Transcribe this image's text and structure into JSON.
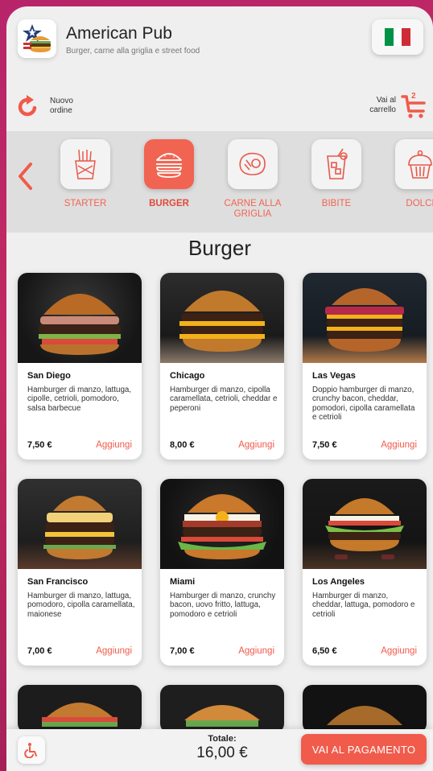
{
  "header": {
    "title": "American Pub",
    "subtitle": "Burger, carne alla griglia e street food",
    "flag_colors": [
      "#009246",
      "#ffffff",
      "#ce2b37"
    ]
  },
  "actions": {
    "new_order": "Nuovo ordine",
    "cart_label": "Vai al carrello",
    "cart_count": "2"
  },
  "categories": [
    {
      "label": "STARTER",
      "icon": "fries-icon",
      "active": false
    },
    {
      "label": "BURGER",
      "icon": "burger-icon",
      "active": true
    },
    {
      "label": "CARNE ALLA GRIGLIA",
      "icon": "steak-icon",
      "active": false
    },
    {
      "label": "BIBITE",
      "icon": "drink-icon",
      "active": false
    },
    {
      "label": "DOLCI",
      "icon": "cupcake-icon",
      "active": false
    }
  ],
  "section_title": "Burger",
  "add_label": "Aggiungi",
  "products": [
    {
      "name": "San Diego",
      "desc": "Hamburger di manzo, lattuga, cipolle, cetrioli, pomodoro, salsa barbecue",
      "price": "7,50 €"
    },
    {
      "name": "Chicago",
      "desc": "Hamburger di manzo, cipolla caramellata, cetrioli, cheddar e peperoni",
      "price": "8,00 €"
    },
    {
      "name": "Las Vegas",
      "desc": "Doppio hamburger di manzo, crunchy bacon, cheddar, pomodori, cipolla caramellata e cetrioli",
      "price": "7,50 €"
    },
    {
      "name": "San Francisco",
      "desc": "Hamburger di manzo, lattuga, pomodoro, cipolla caramellata, maionese",
      "price": "7,00 €"
    },
    {
      "name": "Miami",
      "desc": "Hamburger di manzo, crunchy bacon, uovo fritto, lattuga, pomodoro e cetrioli",
      "price": "7,00 €"
    },
    {
      "name": "Los Angeles",
      "desc": "Hamburger di manzo, cheddar, lattuga, pomodoro e cetrioli",
      "price": "6,50 €"
    }
  ],
  "footer": {
    "total_label": "Totale:",
    "total_value": "16,00 €",
    "pay_label": "VAI AL PAGAMENTO"
  },
  "colors": {
    "accent": "#f15b4b",
    "background": "#efefef",
    "outer": "#b8246a"
  }
}
